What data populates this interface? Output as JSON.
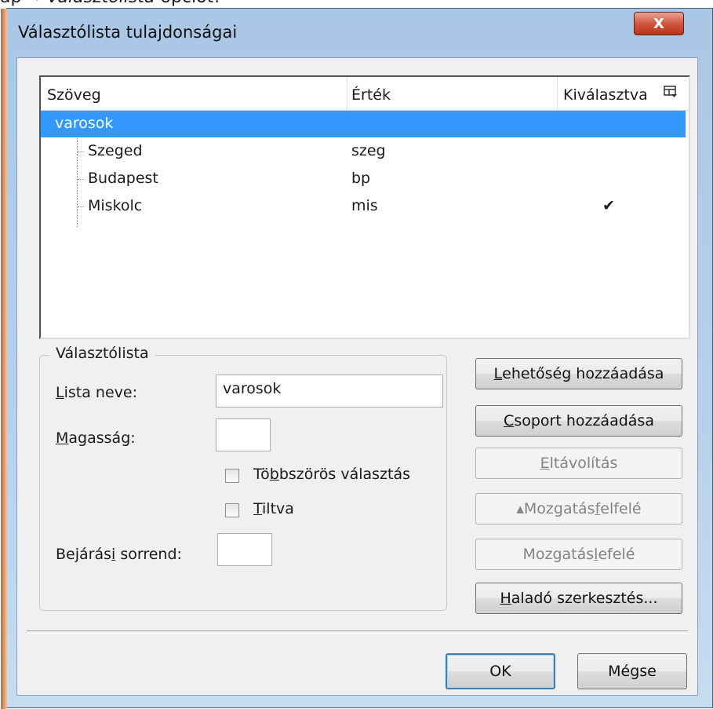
{
  "caption": {
    "prefix": "ap",
    "arrow": "→",
    "italic": "Választólista",
    "suffix": "opciót!"
  },
  "window": {
    "title": "Választólista tulajdonságai",
    "close_glyph": "X"
  },
  "list": {
    "columns": [
      "Szöveg",
      "Érték",
      "Kiválasztva"
    ],
    "column_menu_icon": "column-chooser-icon",
    "group": {
      "label": "varosok"
    },
    "rows": [
      {
        "text": "Szeged",
        "value": "szeg",
        "selected_mark": ""
      },
      {
        "text": "Budapest",
        "value": "bp",
        "selected_mark": ""
      },
      {
        "text": "Miskolc",
        "value": "mis",
        "selected_mark": "✔"
      }
    ]
  },
  "groupbox": {
    "legend": "Választólista",
    "list_name": {
      "label_ul": "L",
      "label_rest": "ista neve:",
      "value": "varosok"
    },
    "height": {
      "label_ul": "M",
      "label_rest": "agasság:",
      "value": ""
    },
    "multi_select": {
      "pre": "Tö",
      "ul": "b",
      "post": "bszörös választás",
      "checked": false
    },
    "disabled": {
      "pre": "",
      "ul": "T",
      "post": "iltva",
      "checked": false
    },
    "tab_order": {
      "pre": "Bejárás",
      "ul": "i",
      "post": " sorrend:",
      "value": ""
    }
  },
  "buttons": {
    "add_option": {
      "ul": "L",
      "rest": "ehetőség hozzáadása"
    },
    "add_group": {
      "ul": "C",
      "rest": "soport hozzáadása"
    },
    "remove": {
      "ul": "E",
      "rest": "ltávolítás"
    },
    "move_up": {
      "pre": "▴Mozgatás ",
      "ul": "f",
      "post": "elfelé"
    },
    "move_down": {
      "pre": "Mozgatás ",
      "ul": "l",
      "post": "efelé"
    },
    "advanced": {
      "ul": "H",
      "rest": "aladó szerkesztés..."
    },
    "ok": "OK",
    "cancel": "Mégse"
  }
}
